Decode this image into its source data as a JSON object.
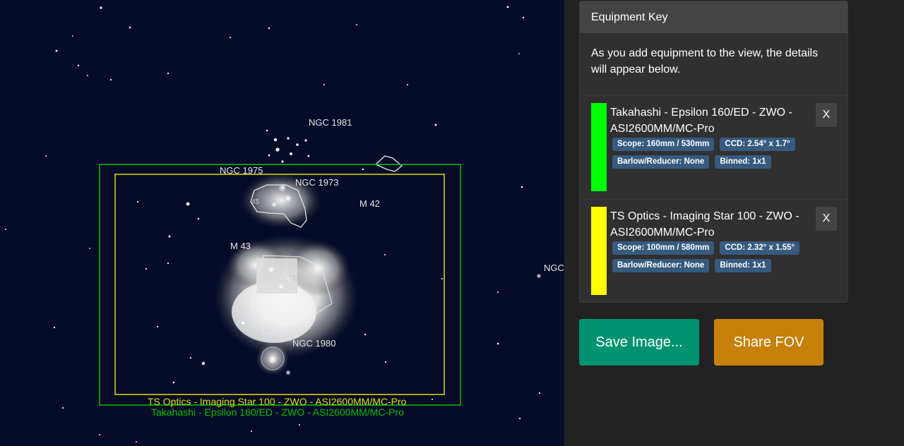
{
  "sky": {
    "labels": {
      "ngc1981": "NGC 1981",
      "ngc1975": "NGC 1975",
      "ngc1973": "NGC 1973",
      "m42": "M 42",
      "m43": "M 43",
      "ngc1980": "NGC 1980",
      "ngc_edge": "NGC",
      "marker_45": "45",
      "marker_41": "41"
    },
    "fov_captions": {
      "yellow": "TS Optics - Imaging Star 100 - ZWO - ASI2600MM/MC-Pro",
      "green": "Takahashi - Epsilon 160/ED - ZWO - ASI2600MM/MC-Pro"
    },
    "colors": {
      "background": "#060b28",
      "green_fov": "#00c000",
      "yellow_fov": "#e0e000"
    }
  },
  "equipment_key": {
    "title": "Equipment Key",
    "intro": "As you add equipment to the view, the details will appear below.",
    "items": [
      {
        "name": "Takahashi - Epsilon 160/ED - ZWO - ASI2600MM/MC-Pro",
        "color": "#00ff00",
        "badges": [
          "Scope: 160mm / 530mm",
          "CCD: 2.54° x 1.7°",
          "Barlow/Reducer: None",
          "Binned: 1x1"
        ],
        "remove_label": "X"
      },
      {
        "name": "TS Optics - Imaging Star 100 - ZWO - ASI2600MM/MC-Pro",
        "color": "#ffff00",
        "badges": [
          "Scope: 100mm / 580mm",
          "CCD: 2.32° x 1.55°",
          "Barlow/Reducer: None",
          "Binned: 1x1"
        ],
        "remove_label": "X"
      }
    ]
  },
  "actions": {
    "save_label": "Save Image...",
    "share_label": "Share FOV"
  }
}
